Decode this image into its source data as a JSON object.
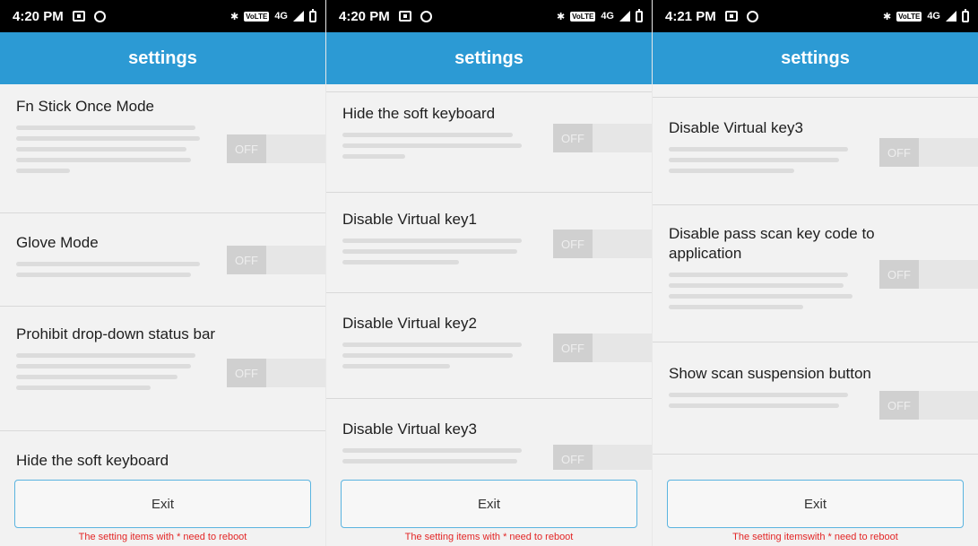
{
  "screens": [
    {
      "status": {
        "time": "4:20 PM",
        "net": "4G"
      },
      "title": "settings",
      "rows": [
        {
          "title": "Fn Stick Once Mode",
          "toggle": "OFF"
        },
        {
          "title": "Glove Mode",
          "toggle": "OFF"
        },
        {
          "title": "Prohibit drop-down status bar",
          "toggle": "OFF"
        },
        {
          "title": "Hide the soft keyboard"
        }
      ],
      "exit": "Exit",
      "note": "The setting items with * need to reboot"
    },
    {
      "status": {
        "time": "4:20 PM",
        "net": "4G"
      },
      "title": "settings",
      "rows": [
        {
          "title": "Hide the soft keyboard",
          "toggle": "OFF"
        },
        {
          "title": "Disable Virtual key1",
          "toggle": "OFF"
        },
        {
          "title": "Disable Virtual key2",
          "toggle": "OFF"
        },
        {
          "title": "Disable Virtual key3",
          "toggle": "OFF"
        }
      ],
      "exit": "Exit",
      "note": "The setting items with * need to reboot"
    },
    {
      "status": {
        "time": "4:21 PM",
        "net": "4G"
      },
      "title": "settings",
      "rows": [
        {
          "title": "Disable Virtual key3",
          "toggle": "OFF"
        },
        {
          "title": "Disable pass scan key code to application",
          "toggle": "OFF"
        },
        {
          "title": "Show scan suspension button",
          "toggle": "OFF"
        }
      ],
      "exit": "Exit",
      "note": "The setting itemswith * need to reboot"
    }
  ],
  "colors": {
    "accent": "#2c9ad4",
    "note": "#e32626",
    "status_bar": "#000000"
  }
}
